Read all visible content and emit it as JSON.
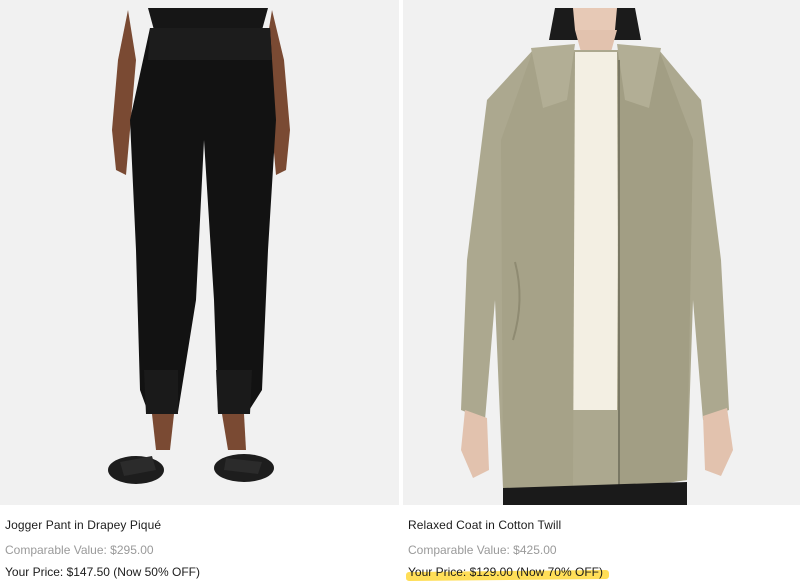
{
  "products": [
    {
      "name": "Jogger Pant in Drapey Piqué",
      "comparable": "Comparable Value: $295.00",
      "price": "Your Price: $147.50 (Now 50% OFF)",
      "image_icon": "product-photo-jogger-pant"
    },
    {
      "name": "Relaxed Coat in Cotton Twill",
      "comparable": "Comparable Value: $425.00",
      "price": "Your Price: $129.00 (Now 70% OFF)",
      "image_icon": "product-photo-relaxed-coat",
      "highlight_color": "#ffd83a"
    }
  ]
}
